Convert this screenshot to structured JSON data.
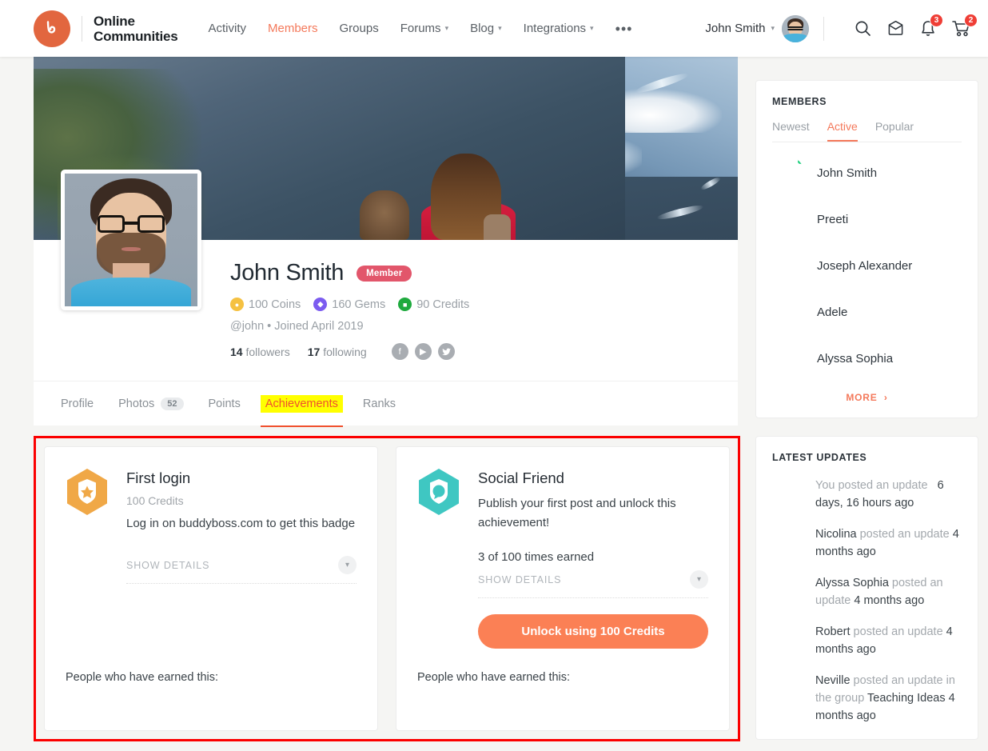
{
  "header": {
    "brand": {
      "line1": "Online",
      "line2": "Communities",
      "logo_icon": "buddyboss-logo-icon"
    },
    "nav": [
      {
        "label": "Activity",
        "caret": false,
        "active": false
      },
      {
        "label": "Members",
        "caret": false,
        "active": true
      },
      {
        "label": "Groups",
        "caret": false,
        "active": false
      },
      {
        "label": "Forums",
        "caret": true,
        "active": false
      },
      {
        "label": "Blog",
        "caret": true,
        "active": false
      },
      {
        "label": "Integrations",
        "caret": true,
        "active": false
      }
    ],
    "more_label": "•••",
    "user_name": "John Smith",
    "user_caret": "⌄",
    "icons": {
      "search": "search-icon",
      "messages": "inbox-icon",
      "notifications": "bell-icon",
      "cart": "cart-icon"
    },
    "notification_count": "3",
    "cart_count": "2",
    "accent_color": "#f4795b",
    "badge_color": "#ef3e36"
  },
  "profile": {
    "name": "John Smith",
    "role_badge": "Member",
    "currencies": [
      {
        "value": "100 Coins",
        "icon": "coin-icon",
        "color": "#f5c142",
        "glyph": "●"
      },
      {
        "value": "160 Gems",
        "icon": "gem-icon",
        "color": "#7c5cf0",
        "glyph": "◆"
      },
      {
        "value": "90 Credits",
        "icon": "credit-icon",
        "color": "#1faa3e",
        "glyph": "⌗"
      }
    ],
    "meta": "@john • Joined April 2019",
    "followers_count": "14",
    "followers_label": "followers",
    "following_count": "17",
    "following_label": "following",
    "socials": [
      {
        "name": "facebook-icon",
        "glyph": "f"
      },
      {
        "name": "youtube-icon",
        "glyph": "▶"
      },
      {
        "name": "twitter-icon",
        "glyph": "ᵕ"
      }
    ]
  },
  "tabs": [
    {
      "label": "Profile",
      "count": null,
      "active": false
    },
    {
      "label": "Photos",
      "count": "52",
      "active": false
    },
    {
      "label": "Points",
      "count": null,
      "active": false
    },
    {
      "label": "Achievements",
      "count": null,
      "active": true
    },
    {
      "label": "Ranks",
      "count": null,
      "active": false
    }
  ],
  "achievements": {
    "highlight_color": "#fb0000",
    "cards": [
      {
        "badge_icon": "shield-star-badge-icon",
        "badge_color": "#f0a847",
        "title": "First login",
        "subtitle": "100 Credits",
        "description": "Log in on buddyboss.com to get this badge",
        "times_earned": null,
        "show_details_label": "SHOW DETAILS",
        "chevron_icon": "chevron-down-icon",
        "unlock_button": null,
        "people_label": "People who have earned this:",
        "people_avatars": [
          "preeti-avatar",
          "john-smith-avatar"
        ]
      },
      {
        "badge_icon": "shield-chat-badge-icon",
        "badge_color": "#3fc7c2",
        "title": "Social Friend",
        "subtitle": null,
        "description": "Publish your first post and unlock this achievement!",
        "times_earned": "3 of 100 times earned",
        "show_details_label": "SHOW DETAILS",
        "chevron_icon": "chevron-down-icon",
        "unlock_button": "Unlock using 100 Credits",
        "people_label": "People who have earned this:",
        "people_avatars": [
          "john-smith-avatar"
        ]
      }
    ]
  },
  "sidebar": {
    "members_widget": {
      "title": "MEMBERS",
      "tabs": [
        {
          "label": "Newest",
          "active": false
        },
        {
          "label": "Active",
          "active": true
        },
        {
          "label": "Popular",
          "active": false
        }
      ],
      "members": [
        {
          "name": "John Smith",
          "online": true
        },
        {
          "name": "Preeti",
          "online": false
        },
        {
          "name": "Joseph Alexander",
          "online": false
        },
        {
          "name": "Adele",
          "online": false
        },
        {
          "name": "Alyssa Sophia",
          "online": false
        }
      ],
      "more_label": "MORE",
      "more_icon": "chevron-right-icon"
    },
    "updates_widget": {
      "title": "LATEST UPDATES",
      "updates": [
        {
          "actor": "",
          "text": "You posted an update",
          "time": "6 days, 16 hours ago",
          "split": true
        },
        {
          "actor": "Nicolina",
          "text": " posted an update ",
          "time": "4 months ago",
          "split": false
        },
        {
          "actor": "Alyssa Sophia",
          "text": " posted an update ",
          "time": "4 months ago",
          "split": false
        },
        {
          "actor": "Robert",
          "text": " posted an update ",
          "time": "4 months ago",
          "split": false
        },
        {
          "actor": "Neville",
          "text": " posted an update in the group ",
          "group": "Teaching Ideas",
          "time": "4 months ago",
          "split": false
        }
      ]
    }
  }
}
